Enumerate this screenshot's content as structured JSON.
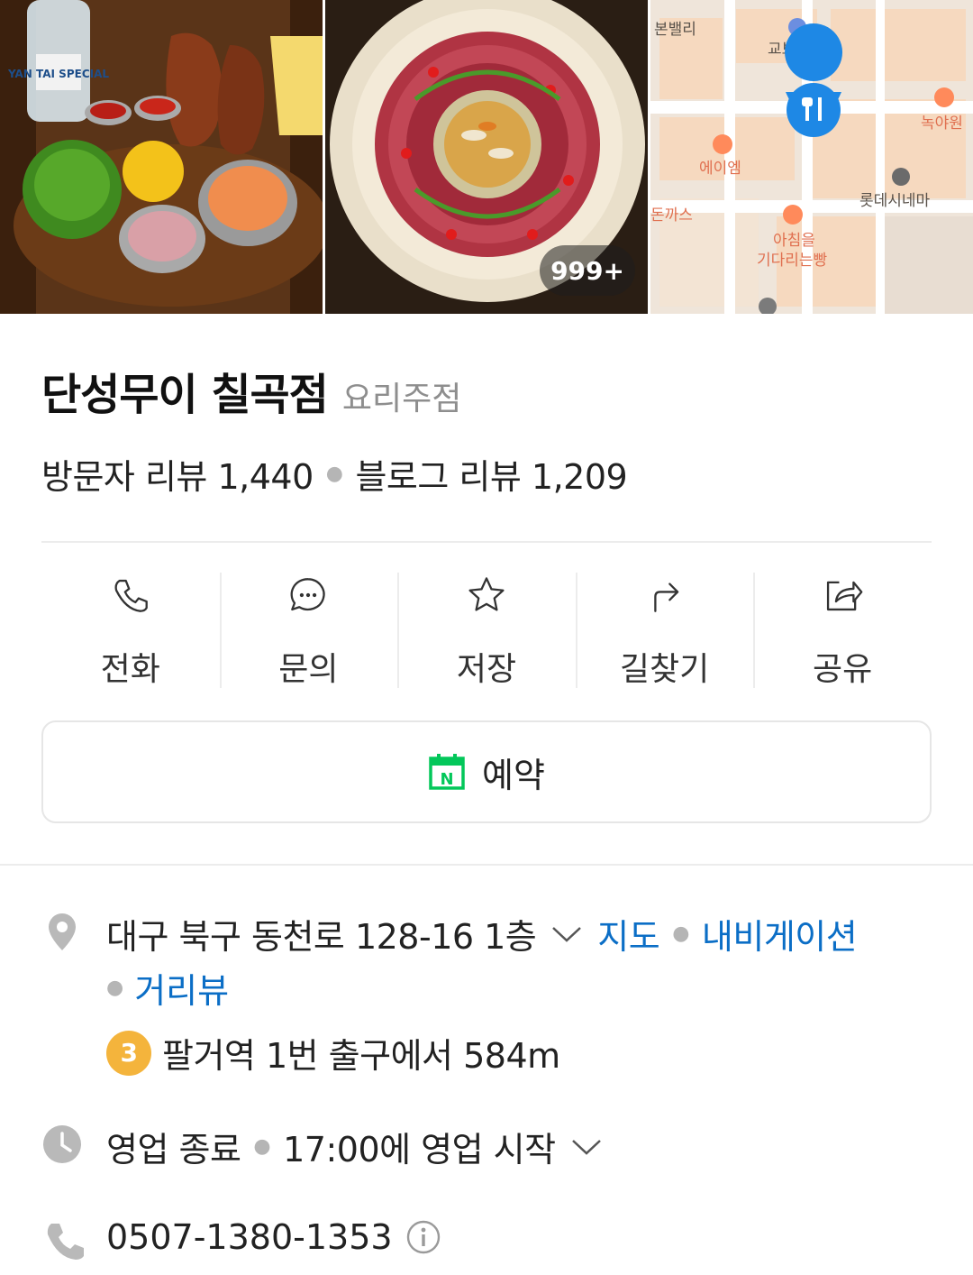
{
  "gallery": {
    "photo1_alt": "YAN TAI SPECIAL",
    "photo_count": "999+",
    "map_labels": [
      "본밸리",
      "교보문고",
      "녹야원",
      "에이엠",
      "롯데시네마",
      "돈까스",
      "아침을",
      "기다리는빵"
    ]
  },
  "place": {
    "name": "단성무이 칠곡점",
    "category": "요리주점",
    "visitor_review_label": "방문자 리뷰 1,440",
    "blog_review_label": "블로그 리뷰 1,209"
  },
  "actions": [
    {
      "label": "전화",
      "icon": "phone-icon"
    },
    {
      "label": "문의",
      "icon": "chat-icon"
    },
    {
      "label": "저장",
      "icon": "star-icon"
    },
    {
      "label": "길찾기",
      "icon": "directions-icon"
    },
    {
      "label": "공유",
      "icon": "share-icon"
    }
  ],
  "reserve": {
    "label": "예약",
    "icon": "naver-calendar-icon",
    "icon_text": "N",
    "color": "#03c75a"
  },
  "address": {
    "text": "대구 북구 동천로 128-16 1층",
    "map_link": "지도",
    "nav_link": "내비게이션",
    "street_view_link": "거리뷰"
  },
  "subway": {
    "line": "3",
    "text": "팔거역 1번 출구에서 584m",
    "line_color": "#f4b43c"
  },
  "hours": {
    "status": "영업 종료",
    "next": "17:00에 영업 시작"
  },
  "phone": {
    "number": "0507-1380-1353"
  },
  "colors": {
    "link": "#0b6ec6",
    "pin": "#1e88e5",
    "icon_gray": "#b9b9b9"
  }
}
